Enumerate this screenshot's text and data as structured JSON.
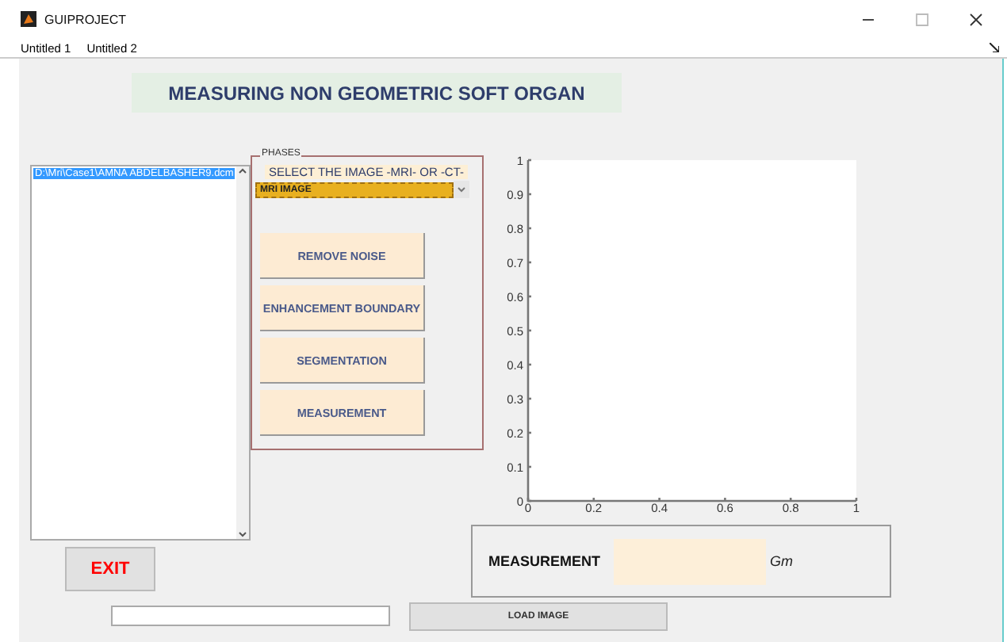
{
  "window": {
    "title": "GUIPROJECT"
  },
  "menu": [
    {
      "label": "Untitled 1"
    },
    {
      "label": "Untitled 2"
    }
  ],
  "heading": "MEASURING NON GEOMETRIC SOFT ORGAN",
  "file_list": {
    "items": [
      {
        "label": "D:\\Mri\\Case1\\AMNA ABDELBASHER9.dcm",
        "selected": true
      }
    ]
  },
  "phases_panel": {
    "title": "PHASES",
    "select_label": "SELECT THE IMAGE -MRI- OR -CT-",
    "dropdown": {
      "value": "MRI IMAGE"
    },
    "buttons": [
      "REMOVE NOISE",
      "ENHANCEMENT BOUNDARY",
      "SEGMENTATION",
      "MEASUREMENT"
    ]
  },
  "chart": {
    "chart_data": {
      "type": "line",
      "xlim": [
        0,
        1
      ],
      "ylim": [
        0,
        1
      ],
      "xticks": [
        0,
        0.2,
        0.4,
        0.6,
        0.8,
        1
      ],
      "yticks": [
        0,
        0.1,
        0.2,
        0.3,
        0.4,
        0.5,
        0.6,
        0.7,
        0.8,
        0.9,
        1
      ]
    }
  },
  "measurement_panel": {
    "label": "MEASUREMENT",
    "unit": "Gm"
  },
  "exit_button": "EXIT",
  "load_button": "LOAD IMAGE"
}
